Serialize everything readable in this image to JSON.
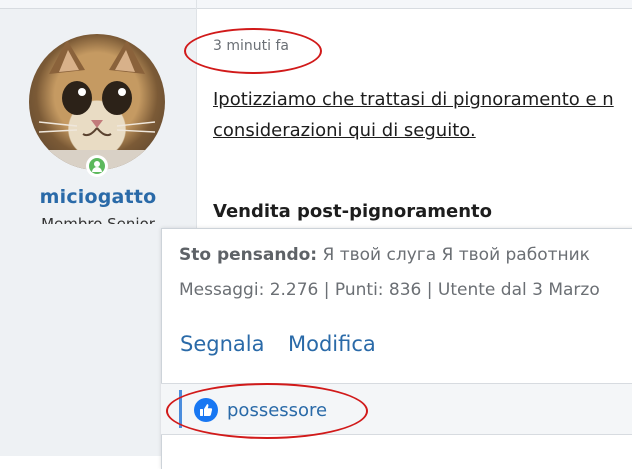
{
  "post": {
    "time": "3 minuti fa",
    "body_lines": [
      "Ipotizziamo che trattasi di pignoramento e n",
      "considerazioni qui di seguito."
    ],
    "heading": "Vendita post-pignoramento"
  },
  "author": {
    "username": "miciogatto",
    "title": "Membro Senior",
    "status": "online"
  },
  "tooltip": {
    "thinking_label": "Sto pensando:",
    "thinking_text": " Я твой слуга Я твой работник",
    "stats": "Messaggi: 2.276 | Punti: 836 | Utente dal 3 Marzo"
  },
  "actions": {
    "report": "Segnala",
    "edit": "Modifica"
  },
  "reactions": {
    "icon": "thumbs-up-icon",
    "user": "possessore"
  },
  "colors": {
    "link": "#2a6aa8",
    "annotation": "#d11a1a",
    "like": "#1877f2",
    "online": "#5cb85c"
  }
}
